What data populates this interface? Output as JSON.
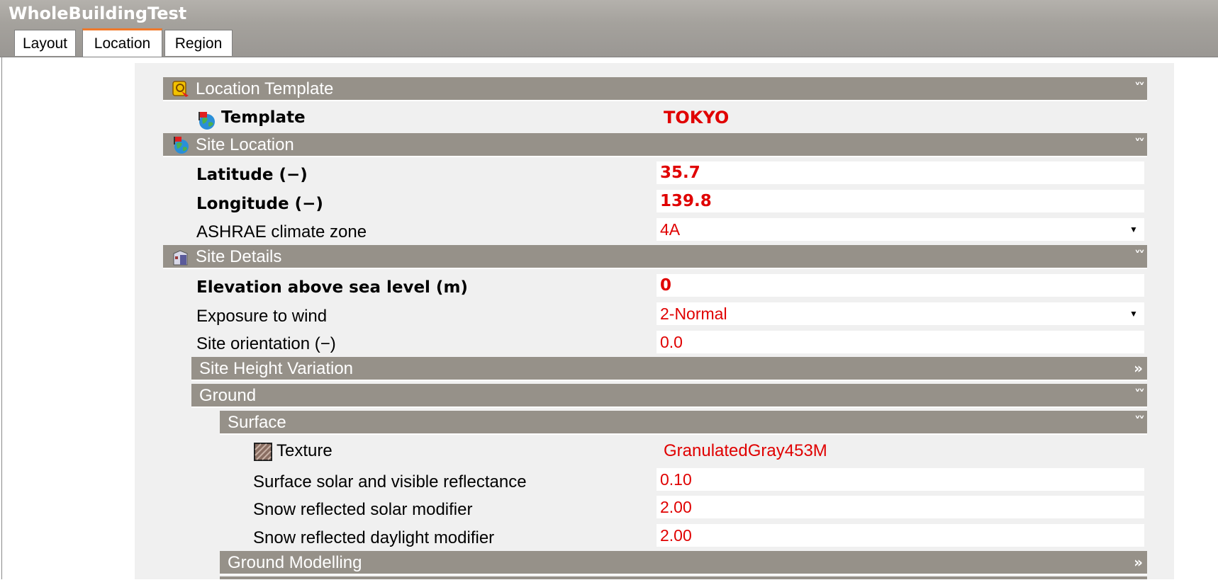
{
  "window": {
    "title": "WholeBuildingTest"
  },
  "tabs": [
    {
      "label": "Layout",
      "active": false
    },
    {
      "label": "Location",
      "active": true
    },
    {
      "label": "Region",
      "active": false
    }
  ],
  "sections": {
    "location_template": {
      "title": "Location Template",
      "template_label": "Template",
      "template_value": "TOKYO"
    },
    "site_location": {
      "title": "Site Location",
      "latitude_label": "Latitude (−)",
      "latitude_value": "35.7",
      "longitude_label": "Longitude (−)",
      "longitude_value": "139.8",
      "climate_zone_label": "ASHRAE climate zone",
      "climate_zone_value": "4A"
    },
    "site_details": {
      "title": "Site Details",
      "elevation_label": "Elevation above sea level (m)",
      "elevation_value": "0",
      "exposure_label": "Exposure to wind",
      "exposure_value": "2-Normal",
      "orientation_label": "Site orientation (−)",
      "orientation_value": "0.0"
    },
    "site_height_variation": {
      "title": "Site Height Variation",
      "chevron": "»"
    },
    "ground": {
      "title": "Ground"
    },
    "surface": {
      "title": "Surface",
      "texture_label": "Texture",
      "texture_value": "GranulatedGray453M",
      "reflectance_label": "Surface solar and visible reflectance",
      "reflectance_value": "0.10",
      "snow_solar_label": "Snow reflected solar modifier",
      "snow_solar_value": "2.00",
      "snow_daylight_label": "Snow reflected daylight modifier",
      "snow_daylight_value": "2.00"
    },
    "ground_modelling": {
      "title": "Ground Modelling",
      "chevron": "»"
    }
  },
  "icons": {
    "collapse": "double-chevron-up-icon",
    "expand": "double-chevron-right-icon",
    "dropdown": "dropdown-arrow-icon"
  },
  "colors": {
    "header_bg": "#969189",
    "value_text": "#e00000",
    "active_tab_accent": "#f07a2c"
  }
}
